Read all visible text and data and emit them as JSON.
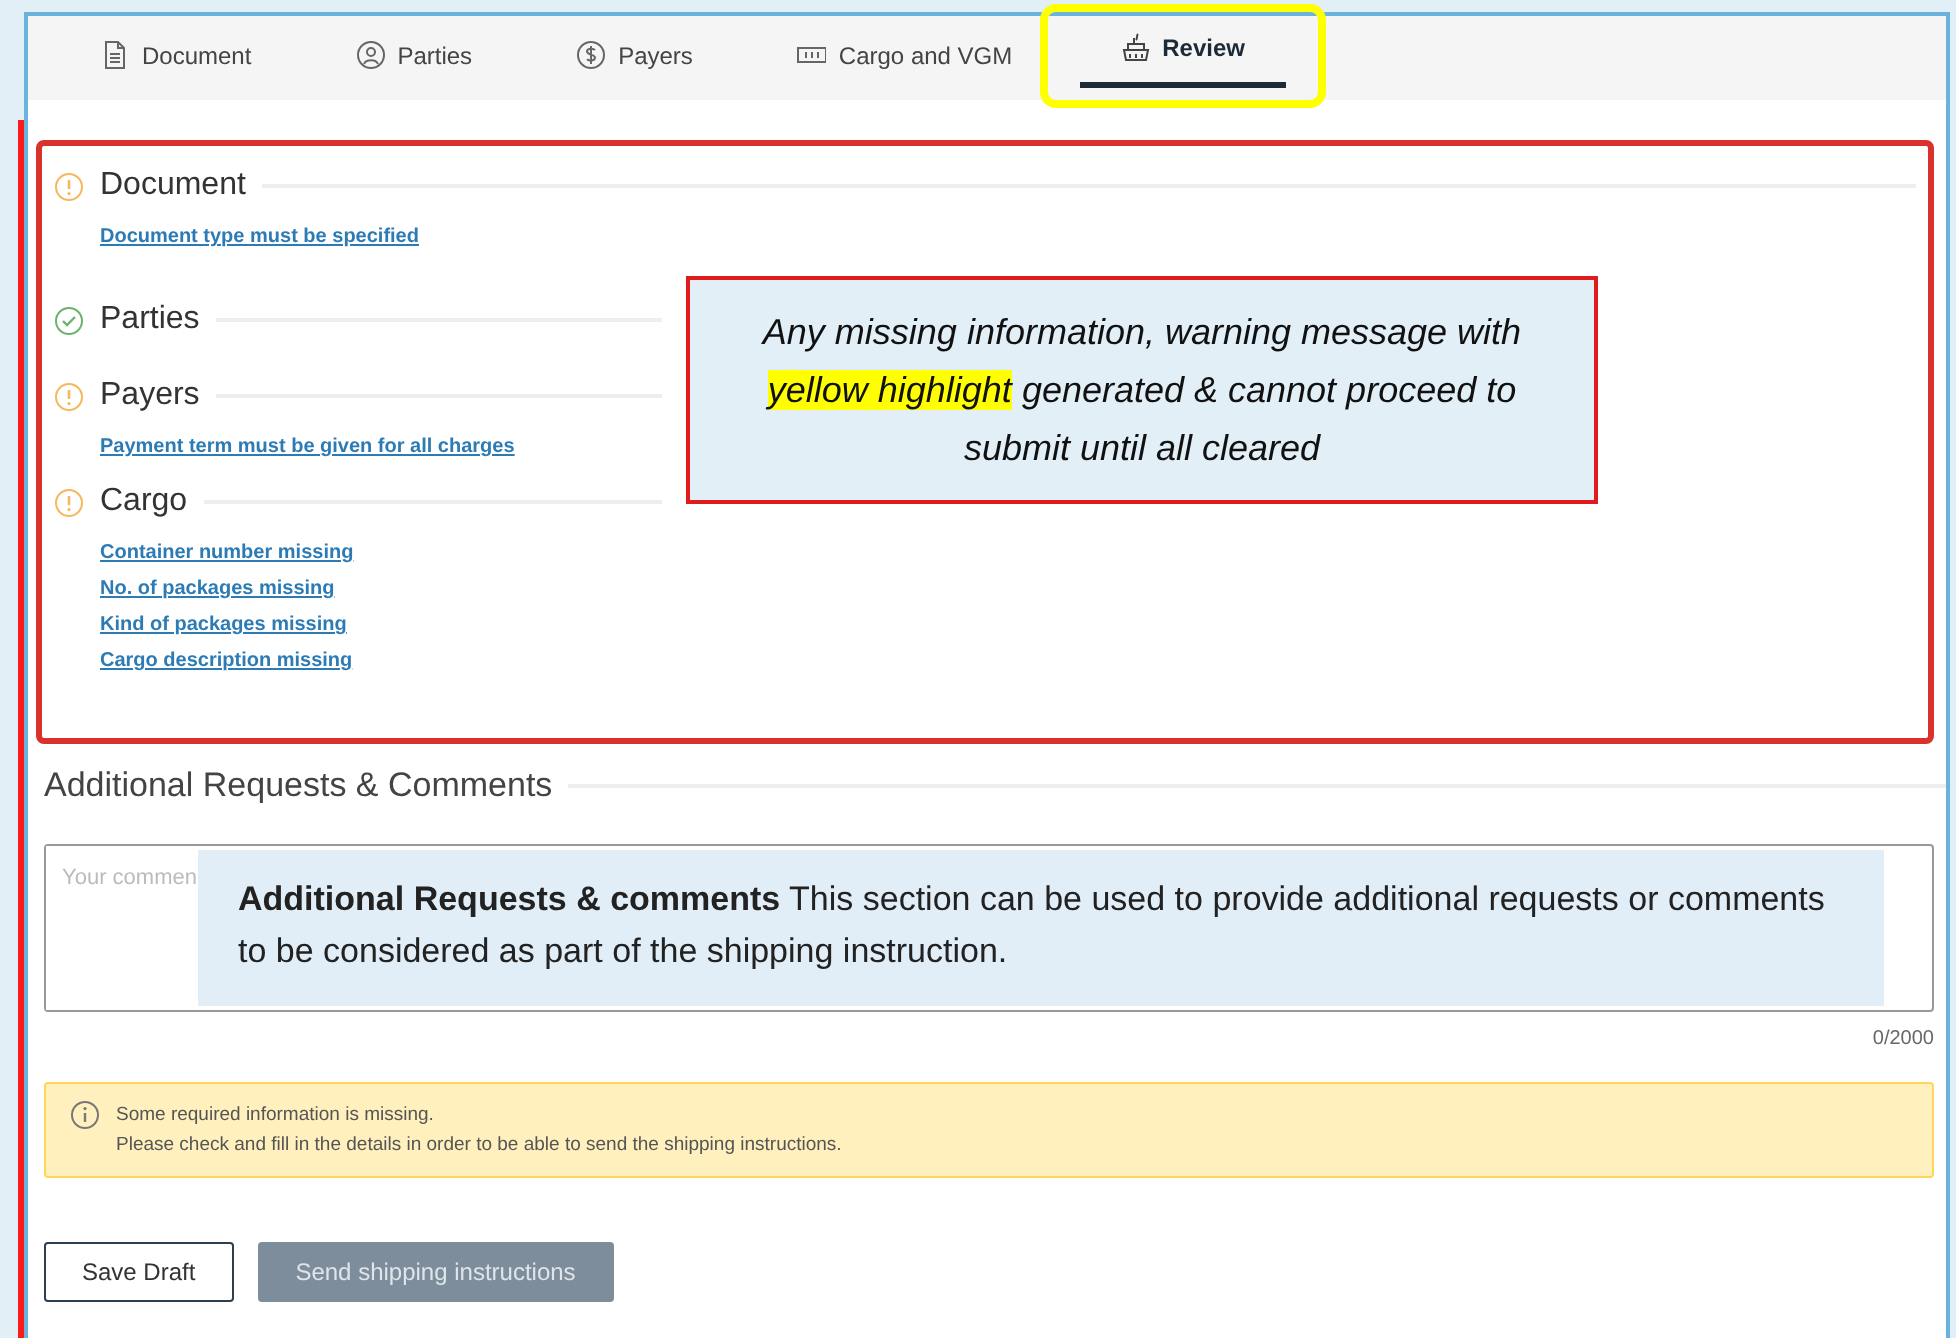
{
  "tabs": [
    {
      "label": "Document",
      "selected": false
    },
    {
      "label": "Parties",
      "selected": false
    },
    {
      "label": "Payers",
      "selected": false
    },
    {
      "label": "Cargo and VGM",
      "selected": false
    },
    {
      "label": "Review",
      "selected": true
    }
  ],
  "sections": [
    {
      "title": "Document",
      "complete": false,
      "links": [
        "Document type must be specified"
      ]
    },
    {
      "title": "Parties",
      "complete": true
    },
    {
      "title": "Payers",
      "complete": false,
      "links": [
        "Payment term must be given for all charges"
      ]
    },
    {
      "title": "Cargo",
      "complete": false,
      "links": [
        "Container number missing",
        "No. of packages missing",
        "Kind of packages missing",
        "Cargo description missing"
      ]
    }
  ],
  "callout": {
    "before": "Any missing information, warning message with ",
    "highlight": "yellow highlight",
    "after": " generated & cannot proceed to submit until all cleared"
  },
  "comments": {
    "heading": "Additional Requests & Comments",
    "placeholder": "Your commen",
    "counter": "0/2000",
    "note": "**Additional Requests & comments** This section can be used to provide additional requests or comments to be considered as part of the shipping instruction."
  },
  "alert": {
    "lines": [
      "Some required information is missing.",
      "Please check and fill in the details in order to be able to send the shipping instructions."
    ]
  },
  "buttons": [
    {
      "label": "Save Draft",
      "kind": "outline",
      "disabled": false
    },
    {
      "label": "Send shipping instructions",
      "kind": "primary",
      "disabled": true
    }
  ]
}
